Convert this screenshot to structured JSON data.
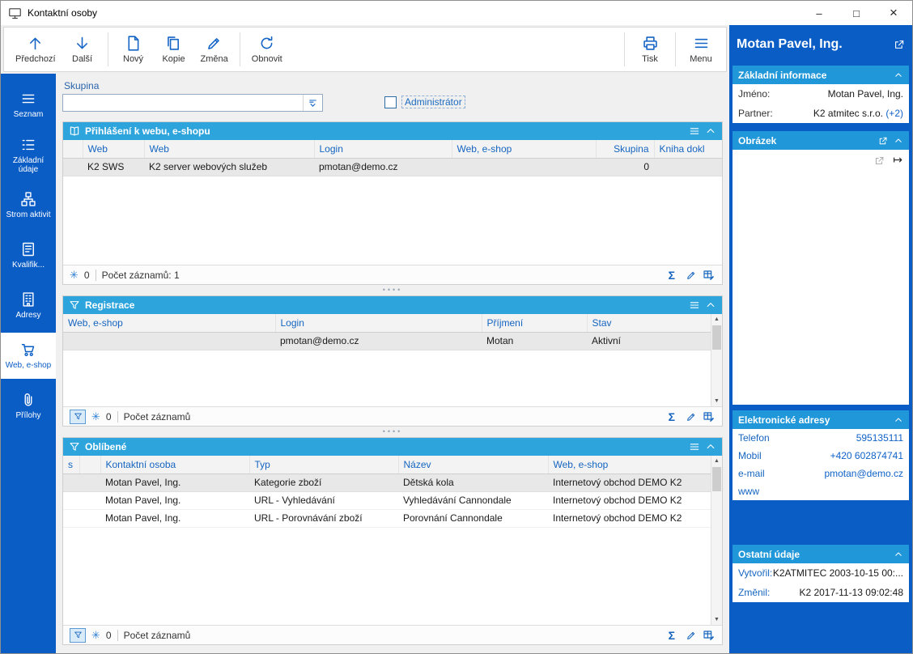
{
  "window": {
    "title": "Kontaktní osoby"
  },
  "glyphs": {
    "minimize": "–",
    "maximize": "□",
    "close": "×",
    "snowflake": "✳",
    "sigma": "Σ",
    "arrow_up": "▲",
    "arrow_down": "▼",
    "splitter_dots": "••••",
    "mapsto": "↦"
  },
  "colors": {
    "brand_blue": "#0b5dc6",
    "panel_header_blue": "#2ea4dd",
    "section_header_blue": "#2097d8",
    "accent_blue": "#1565c0",
    "link_blue": "#0f62c8",
    "row_highlight": "#e8e8e8"
  },
  "toolbar": {
    "items": [
      {
        "icon": "arrow-up-icon",
        "label": "Předchozí"
      },
      {
        "icon": "arrow-down-icon",
        "label": "Další"
      },
      {
        "icon": "new-document-icon",
        "label": "Nový"
      },
      {
        "icon": "copy-icon",
        "label": "Kopie"
      },
      {
        "icon": "pencil-icon",
        "label": "Změna"
      },
      {
        "icon": "refresh-icon",
        "label": "Obnovit"
      },
      {
        "icon": "printer-icon",
        "label": "Tisk"
      },
      {
        "icon": "hamburger-icon",
        "label": "Menu"
      }
    ]
  },
  "sidebar": {
    "items": [
      {
        "icon": "list-icon",
        "label": "Seznam",
        "active": false
      },
      {
        "icon": "detail-list-icon",
        "label": "Základní údaje",
        "active": false
      },
      {
        "icon": "tree-icon",
        "label": "Strom aktivit",
        "active": false
      },
      {
        "icon": "document-icon",
        "label": "Kvalifik...",
        "active": false
      },
      {
        "icon": "building-icon",
        "label": "Adresy",
        "active": false
      },
      {
        "icon": "cart-icon",
        "label": "Web, e-shop",
        "active": true
      },
      {
        "icon": "paperclip-icon",
        "label": "Přílohy",
        "active": false
      }
    ]
  },
  "filters": {
    "group_label": "Skupina",
    "group_value": "",
    "admin_label": "Administrátor"
  },
  "panels": {
    "logins": {
      "title": "Přihlášení k webu, e-shopu",
      "columns": [
        "",
        "Web",
        "Web",
        "Login",
        "Web, e-shop",
        "Skupina",
        "Kniha dokl"
      ],
      "rows": [
        [
          "",
          "K2 SWS",
          "K2 server webových služeb",
          "pmotan@demo.cz",
          "",
          "0",
          ""
        ]
      ],
      "frozen_count": "0",
      "count_label": "Počet záznamů: 1"
    },
    "registrations": {
      "title": "Registrace",
      "columns": [
        "Web, e-shop",
        "Login",
        "Příjmení",
        "Stav"
      ],
      "rows": [
        [
          "",
          "pmotan@demo.cz",
          "Motan",
          "Aktivní"
        ]
      ],
      "frozen_count": "0",
      "count_label": "Počet záznamů"
    },
    "favorites": {
      "title": "Oblíbené",
      "columns": [
        "s",
        "",
        "Kontaktní osoba",
        "Typ",
        "Název",
        "Web, e-shop"
      ],
      "rows": [
        [
          "",
          "",
          "Motan Pavel, Ing.",
          "Kategorie zboží",
          "Dětská kola",
          "Internetový obchod DEMO K2"
        ],
        [
          "",
          "",
          "Motan Pavel, Ing.",
          "URL - Vyhledávání",
          "Vyhledávání Cannondale",
          "Internetový obchod DEMO K2"
        ],
        [
          "",
          "",
          "Motan Pavel, Ing.",
          "URL - Porovnávání zboží",
          "Porovnání Cannondale",
          "Internetový obchod DEMO K2"
        ]
      ],
      "frozen_count": "0",
      "count_label": "Počet záznamů"
    }
  },
  "detail": {
    "title": "Motan Pavel, Ing.",
    "sections": {
      "basic": {
        "title": "Základní informace",
        "rows": [
          {
            "label": "Jméno:",
            "value": "Motan Pavel, Ing."
          },
          {
            "label": "Partner:",
            "value": "K2 atmitec s.r.o.",
            "link": "(+2)"
          }
        ]
      },
      "picture": {
        "title": "Obrázek"
      },
      "eaddresses": {
        "title": "Elektronické adresy",
        "rows": [
          {
            "label": "Telefon",
            "value": "595135111"
          },
          {
            "label": "Mobil",
            "value": "+420 602874741"
          },
          {
            "label": "e-mail",
            "value": "pmotan@demo.cz"
          },
          {
            "label": "www",
            "value": ""
          }
        ]
      },
      "other": {
        "title": "Ostatní údaje",
        "rows": [
          {
            "label": "Vytvořil:",
            "value": "K2ATMITEC 2003-10-15 00:..."
          },
          {
            "label": "Změnil:",
            "value": "K2 2017-11-13 09:02:48"
          }
        ]
      }
    }
  }
}
